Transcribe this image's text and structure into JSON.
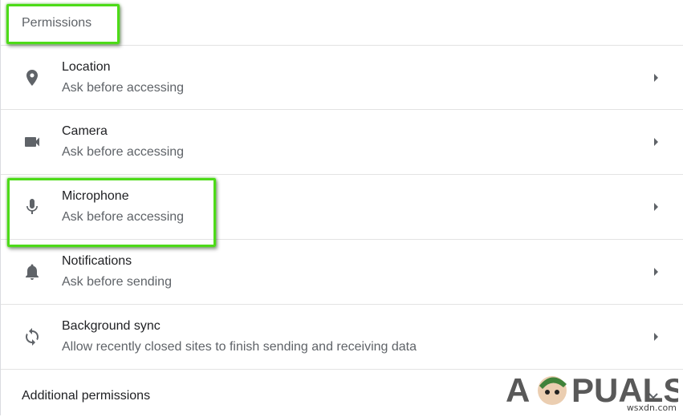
{
  "section": {
    "title": "Permissions"
  },
  "rows": [
    {
      "icon": "location-pin-icon",
      "title": "Location",
      "subtitle": "Ask before accessing"
    },
    {
      "icon": "camera-icon",
      "title": "Camera",
      "subtitle": "Ask before accessing"
    },
    {
      "icon": "microphone-icon",
      "title": "Microphone",
      "subtitle": "Ask before accessing"
    },
    {
      "icon": "bell-icon",
      "title": "Notifications",
      "subtitle": "Ask before sending"
    },
    {
      "icon": "sync-icon",
      "title": "Background sync",
      "subtitle": "Allow recently closed sites to finish sending and receiving data"
    }
  ],
  "additional": {
    "label": "Additional permissions"
  },
  "watermark": {
    "brand": "APPUALS",
    "site": "wsxdn.com"
  },
  "colors": {
    "highlight": "#4ddb18",
    "icon": "#5f6368",
    "text": "#202124",
    "subtext": "#5f6368"
  }
}
